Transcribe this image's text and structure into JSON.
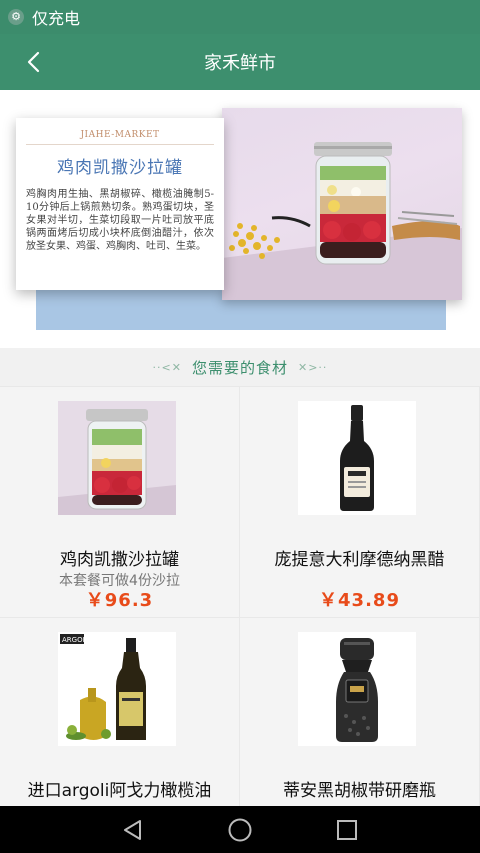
{
  "status_bar": {
    "text": "仅充电"
  },
  "app_bar": {
    "title": "家禾鲜市"
  },
  "banner": {
    "brand": "JIAHE-MARKET",
    "heading": "鸡肉凯撒沙拉罐",
    "description": "鸡胸肉用生抽、黑胡椒碎、橄榄油腌制5-10分钟后上锅煎熟切条。熟鸡蛋切块，圣女果对半切，生菜切段取一片吐司放平底锅两面烤后切成小块杯底倒油醋汁，依次放圣女果、鸡蛋、鸡胸肉、吐司、生菜。"
  },
  "section": {
    "title": "您需要的食材",
    "deco_left": "··<✕",
    "deco_right": "✕>··"
  },
  "products": [
    {
      "name": "鸡肉凯撒沙拉罐",
      "subtitle": "本套餐可做4份沙拉",
      "price": "￥96.3",
      "icon": "salad-jar-icon"
    },
    {
      "name": "庞提意大利摩德纳黑醋",
      "subtitle": "",
      "price": "￥43.89",
      "icon": "vinegar-bottle-icon"
    },
    {
      "name": "进口argoli阿戈力橄榄油",
      "subtitle": "",
      "price": "",
      "icon": "olive-oil-bottle-icon",
      "label": "ARGOLI"
    },
    {
      "name": "蒂安黑胡椒带研磨瓶",
      "subtitle": "",
      "price": "",
      "icon": "pepper-grinder-icon"
    }
  ],
  "colors": {
    "primary": "#3d8f6e",
    "price": "#e84b1a"
  }
}
